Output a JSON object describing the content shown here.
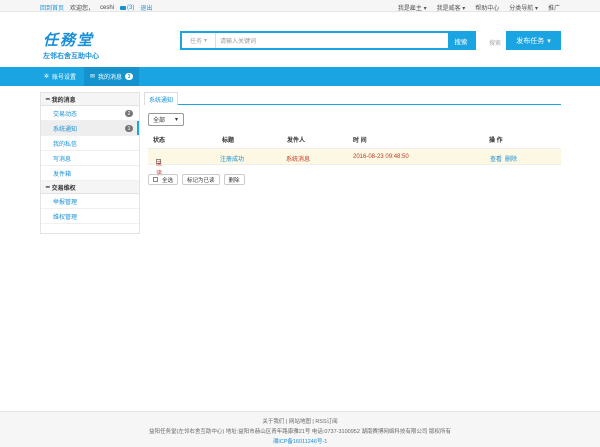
{
  "topbar": {
    "home": "回到首页",
    "welcome": "欢迎您，",
    "username": "ceshi",
    "messages": "(3)",
    "logout": "退出",
    "menu": [
      "我是雇主 ▾",
      "我是威客 ▾",
      "帮助中心",
      "分类导航 ▾",
      "推广"
    ]
  },
  "header": {
    "logo_script": "任務堂",
    "logo_tagline": "左邻右舍互助中心",
    "search_type": "任务",
    "search_placeholder": "请输入关键词",
    "search_button": "搜索",
    "hot_label": "搜索",
    "publish_button": "发布任务"
  },
  "nav": {
    "account": "账号设置",
    "my_messages": "我的消息",
    "my_messages_count": "3"
  },
  "sidebar": {
    "group1_title": "我的消息",
    "items": [
      {
        "label": "交易动态",
        "count": "2"
      },
      {
        "label": "系统通知",
        "count": "1"
      },
      {
        "label": "我的私信",
        "count": ""
      },
      {
        "label": "写消息",
        "count": ""
      },
      {
        "label": "发件箱",
        "count": ""
      }
    ],
    "group2_title": "交易维权",
    "items2": [
      {
        "label": "举报管理"
      },
      {
        "label": "维权管理"
      }
    ]
  },
  "main": {
    "tab": "系统通知",
    "filter": "全部",
    "headers": {
      "status": "状态",
      "title": "标题",
      "sender": "发件人",
      "time": "时 间",
      "ops": "操 作"
    },
    "rows": [
      {
        "status": "未读",
        "title": "注册成功",
        "sender": "系统消息",
        "time": "2016-08-23 09:48:50",
        "view": "查看",
        "delete": "删除"
      }
    ],
    "btn_select_all": "全选",
    "btn_mark_read": "标记为已读",
    "btn_delete": "删除"
  },
  "footer": {
    "links": "关于我们 | 网站地图 | RSS订阅",
    "copyright": "益阳任务堂(左邻右舍互助中心) 地址:益阳市赫山区青年路康雅21号 电话:0737-3100952 湖南赛博网络科技有限公司 版权所有",
    "icp": "湘ICP备16011246号-1"
  },
  "colors": {
    "accent": "#1aa4e2",
    "link": "#1a8fd6",
    "unread": "#c0392b",
    "row_highlight": "#fcf8e3"
  }
}
